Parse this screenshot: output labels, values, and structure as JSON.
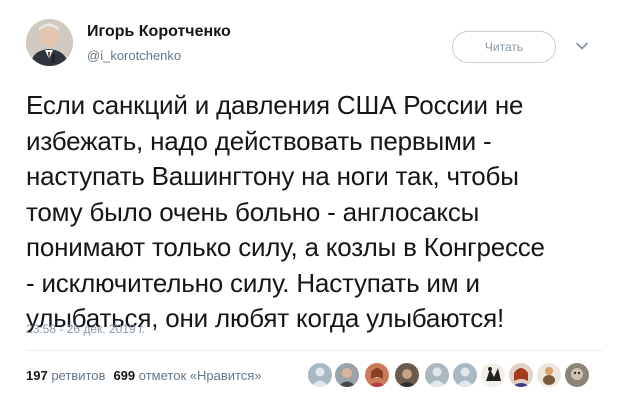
{
  "author": {
    "name": "Игорь Коротченко",
    "handle": "@i_korotchenko",
    "follow_label": "Читать"
  },
  "tweet": {
    "text": "Если санкций и давления США России не\nизбежать, надо действовать первыми -\nнаступать Вашингтону на ноги так, чтобы\nтому было очень больно - англосаксы\nпонимают только силу, а козлы в Конгрессе\n- исключительно силу. Наступать им и\nулыбаться, они любят когда улыбаются!",
    "timestamp": "23:58 - 26 дек. 2019 г."
  },
  "stats": {
    "retweets_count": "197",
    "retweets_label": "ретвитов",
    "likes_count": "699",
    "likes_label": "отметок «Нравится»"
  },
  "liker_avatars": [
    "default-avatar",
    "photo-avatar",
    "photo-avatar",
    "photo-avatar",
    "default-avatar",
    "default-avatar",
    "photo-avatar",
    "photo-avatar",
    "photo-avatar",
    "photo-avatar"
  ]
}
